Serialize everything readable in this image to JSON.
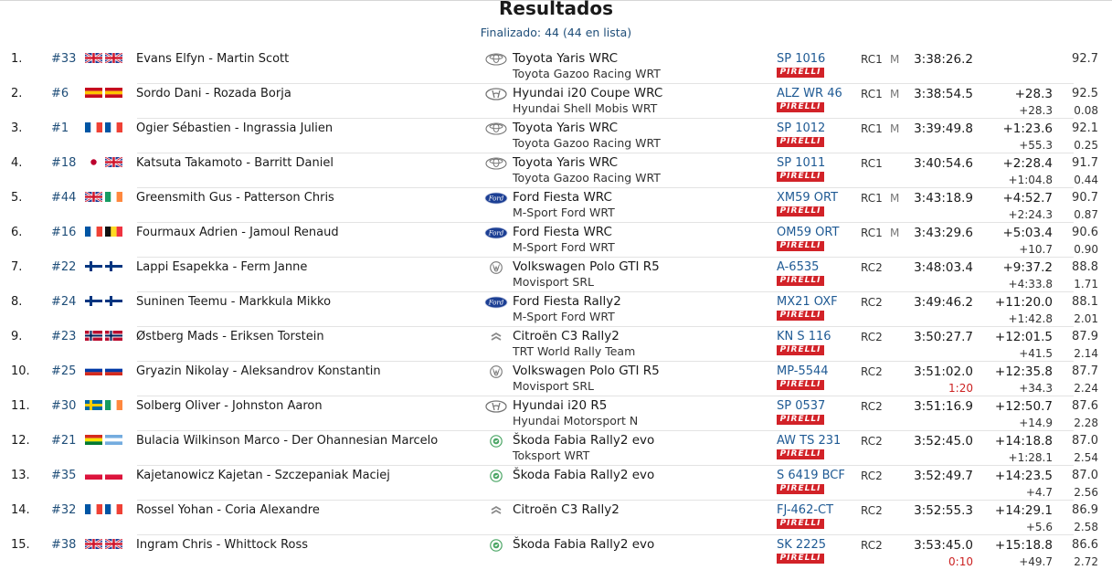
{
  "header": {
    "title": "Resultados",
    "subtitle": "Finalizado: 44 (44 en lista)"
  },
  "flag_colors": {
    "gb": [
      "#1f3a93",
      "#ffffff",
      "#cf142b"
    ],
    "es": [
      "#c60b1e",
      "#ffc400",
      "#c60b1e"
    ],
    "fr": [
      "#0055a4",
      "#ffffff",
      "#ef4135"
    ],
    "jp": [
      "#ffffff",
      "#bc002d"
    ],
    "ie": [
      "#169b62",
      "#ffffff",
      "#ff883e"
    ],
    "be": [
      "#111111",
      "#fdda24",
      "#ef3340"
    ],
    "fi": [
      "#ffffff",
      "#003580"
    ],
    "no": [
      "#ba0c2f",
      "#ffffff",
      "#00205b"
    ],
    "ru": [
      "#ffffff",
      "#0039a6",
      "#d52b1e"
    ],
    "se": [
      "#006aa7",
      "#fecc00"
    ],
    "bo": [
      "#d52b1e",
      "#f9e300",
      "#007934"
    ],
    "ar": [
      "#74acdf",
      "#ffffff",
      "#74acdf"
    ],
    "pl": [
      "#ffffff",
      "#dc143c"
    ]
  },
  "tyre_label": "PIRELLI",
  "rows": [
    {
      "pos": "1.",
      "num": "#33",
      "flags": [
        "gb",
        "gb"
      ],
      "crew": "Evans Elfyn - Martin Scott",
      "brand": "toyota-icon",
      "car": "Toyota Yaris WRC",
      "team": "Toyota Gazoo Racing WRT",
      "plate": "SP 1016",
      "cls": "RC1",
      "m": "M",
      "time": "3:38:26.2",
      "pen": "",
      "gap": "",
      "gap_prev": "",
      "speed": "92.7",
      "diff": ""
    },
    {
      "pos": "2.",
      "num": "#6",
      "flags": [
        "es",
        "es"
      ],
      "crew": "Sordo Dani - Rozada Borja",
      "brand": "hyundai-icon",
      "car": "Hyundai i20 Coupe WRC",
      "team": "Hyundai Shell Mobis WRT",
      "plate": "ALZ WR 46",
      "cls": "RC1",
      "m": "M",
      "time": "3:38:54.5",
      "pen": "",
      "gap": "+28.3",
      "gap_prev": "+28.3",
      "speed": "92.5",
      "diff": "0.08"
    },
    {
      "pos": "3.",
      "num": "#1",
      "flags": [
        "fr",
        "fr"
      ],
      "crew": "Ogier Sébastien - Ingrassia Julien",
      "brand": "toyota-icon",
      "car": "Toyota Yaris WRC",
      "team": "Toyota Gazoo Racing WRT",
      "plate": "SP 1012",
      "cls": "RC1",
      "m": "M",
      "time": "3:39:49.8",
      "pen": "",
      "gap": "+1:23.6",
      "gap_prev": "+55.3",
      "speed": "92.1",
      "diff": "0.25"
    },
    {
      "pos": "4.",
      "num": "#18",
      "flags": [
        "jp",
        "gb"
      ],
      "crew": "Katsuta Takamoto - Barritt Daniel",
      "brand": "toyota-icon",
      "car": "Toyota Yaris WRC",
      "team": "Toyota Gazoo Racing WRT",
      "plate": "SP 1011",
      "cls": "RC1",
      "m": "",
      "time": "3:40:54.6",
      "pen": "",
      "gap": "+2:28.4",
      "gap_prev": "+1:04.8",
      "speed": "91.7",
      "diff": "0.44"
    },
    {
      "pos": "5.",
      "num": "#44",
      "flags": [
        "gb",
        "ie"
      ],
      "crew": "Greensmith Gus - Patterson Chris",
      "brand": "ford-icon",
      "car": "Ford Fiesta WRC",
      "team": "M-Sport Ford WRT",
      "plate": "XM59 ORT",
      "cls": "RC1",
      "m": "M",
      "time": "3:43:18.9",
      "pen": "",
      "gap": "+4:52.7",
      "gap_prev": "+2:24.3",
      "speed": "90.7",
      "diff": "0.87"
    },
    {
      "pos": "6.",
      "num": "#16",
      "flags": [
        "fr",
        "be"
      ],
      "crew": "Fourmaux Adrien - Jamoul Renaud",
      "brand": "ford-icon",
      "car": "Ford Fiesta WRC",
      "team": "M-Sport Ford WRT",
      "plate": "OM59 ORT",
      "cls": "RC1",
      "m": "M",
      "time": "3:43:29.6",
      "pen": "",
      "gap": "+5:03.4",
      "gap_prev": "+10.7",
      "speed": "90.6",
      "diff": "0.90"
    },
    {
      "pos": "7.",
      "num": "#22",
      "flags": [
        "fi",
        "fi"
      ],
      "crew": "Lappi Esapekka - Ferm Janne",
      "brand": "volkswagen-icon",
      "car": "Volkswagen Polo GTI R5",
      "team": "Movisport SRL",
      "plate": "A-6535",
      "cls": "RC2",
      "m": "",
      "time": "3:48:03.4",
      "pen": "",
      "gap": "+9:37.2",
      "gap_prev": "+4:33.8",
      "speed": "88.8",
      "diff": "1.71"
    },
    {
      "pos": "8.",
      "num": "#24",
      "flags": [
        "fi",
        "fi"
      ],
      "crew": "Suninen Teemu - Markkula Mikko",
      "brand": "ford-icon",
      "car": "Ford Fiesta Rally2",
      "team": "M-Sport Ford WRT",
      "plate": "MX21 OXF",
      "cls": "RC2",
      "m": "",
      "time": "3:49:46.2",
      "pen": "",
      "gap": "+11:20.0",
      "gap_prev": "+1:42.8",
      "speed": "88.1",
      "diff": "2.01"
    },
    {
      "pos": "9.",
      "num": "#23",
      "flags": [
        "no",
        "no"
      ],
      "crew": "Østberg Mads - Eriksen Torstein",
      "brand": "citroen-icon",
      "car": "Citroën C3 Rally2",
      "team": "TRT World Rally Team",
      "plate": "KN S 116",
      "cls": "RC2",
      "m": "",
      "time": "3:50:27.7",
      "pen": "",
      "gap": "+12:01.5",
      "gap_prev": "+41.5",
      "speed": "87.9",
      "diff": "2.14"
    },
    {
      "pos": "10.",
      "num": "#25",
      "flags": [
        "ru",
        "ru"
      ],
      "crew": "Gryazin Nikolay - Aleksandrov Konstantin",
      "brand": "volkswagen-icon",
      "car": "Volkswagen Polo GTI R5",
      "team": "Movisport SRL",
      "plate": "MP-5544",
      "cls": "RC2",
      "m": "",
      "time": "3:51:02.0",
      "pen": "1:20",
      "gap": "+12:35.8",
      "gap_prev": "+34.3",
      "speed": "87.7",
      "diff": "2.24"
    },
    {
      "pos": "11.",
      "num": "#30",
      "flags": [
        "se",
        "ie"
      ],
      "crew": "Solberg Oliver - Johnston Aaron",
      "brand": "hyundai-icon",
      "car": "Hyundai i20 R5",
      "team": "Hyundai Motorsport N",
      "plate": "SP 0537",
      "cls": "RC2",
      "m": "",
      "time": "3:51:16.9",
      "pen": "",
      "gap": "+12:50.7",
      "gap_prev": "+14.9",
      "speed": "87.6",
      "diff": "2.28"
    },
    {
      "pos": "12.",
      "num": "#21",
      "flags": [
        "bo",
        "ar"
      ],
      "crew": "Bulacia Wilkinson Marco - Der Ohannesian Marcelo",
      "brand": "skoda-icon",
      "car": "Škoda Fabia Rally2 evo",
      "team": "Toksport WRT",
      "plate": "AW TS 231",
      "cls": "RC2",
      "m": "",
      "time": "3:52:45.0",
      "pen": "",
      "gap": "+14:18.8",
      "gap_prev": "+1:28.1",
      "speed": "87.0",
      "diff": "2.54"
    },
    {
      "pos": "13.",
      "num": "#35",
      "flags": [
        "pl",
        "pl"
      ],
      "crew": "Kajetanowicz Kajetan - Szczepaniak Maciej",
      "brand": "skoda-icon",
      "car": "Škoda Fabia Rally2 evo",
      "team": "",
      "plate": "S 6419 BCF",
      "cls": "RC2",
      "m": "",
      "time": "3:52:49.7",
      "pen": "",
      "gap": "+14:23.5",
      "gap_prev": "+4.7",
      "speed": "87.0",
      "diff": "2.56"
    },
    {
      "pos": "14.",
      "num": "#32",
      "flags": [
        "fr",
        "fr"
      ],
      "crew": "Rossel Yohan - Coria Alexandre",
      "brand": "citroen-icon",
      "car": "Citroën C3 Rally2",
      "team": "",
      "plate": "FJ-462-CT",
      "cls": "RC2",
      "m": "",
      "time": "3:52:55.3",
      "pen": "",
      "gap": "+14:29.1",
      "gap_prev": "+5.6",
      "speed": "86.9",
      "diff": "2.58"
    },
    {
      "pos": "15.",
      "num": "#38",
      "flags": [
        "gb",
        "gb"
      ],
      "crew": "Ingram Chris - Whittock Ross",
      "brand": "skoda-icon",
      "car": "Škoda Fabia Rally2 evo",
      "team": "",
      "plate": "SK 2225",
      "cls": "RC2",
      "m": "",
      "time": "3:53:45.0",
      "pen": "0:10",
      "gap": "+15:18.8",
      "gap_prev": "+49.7",
      "speed": "86.6",
      "diff": "2.72"
    }
  ]
}
